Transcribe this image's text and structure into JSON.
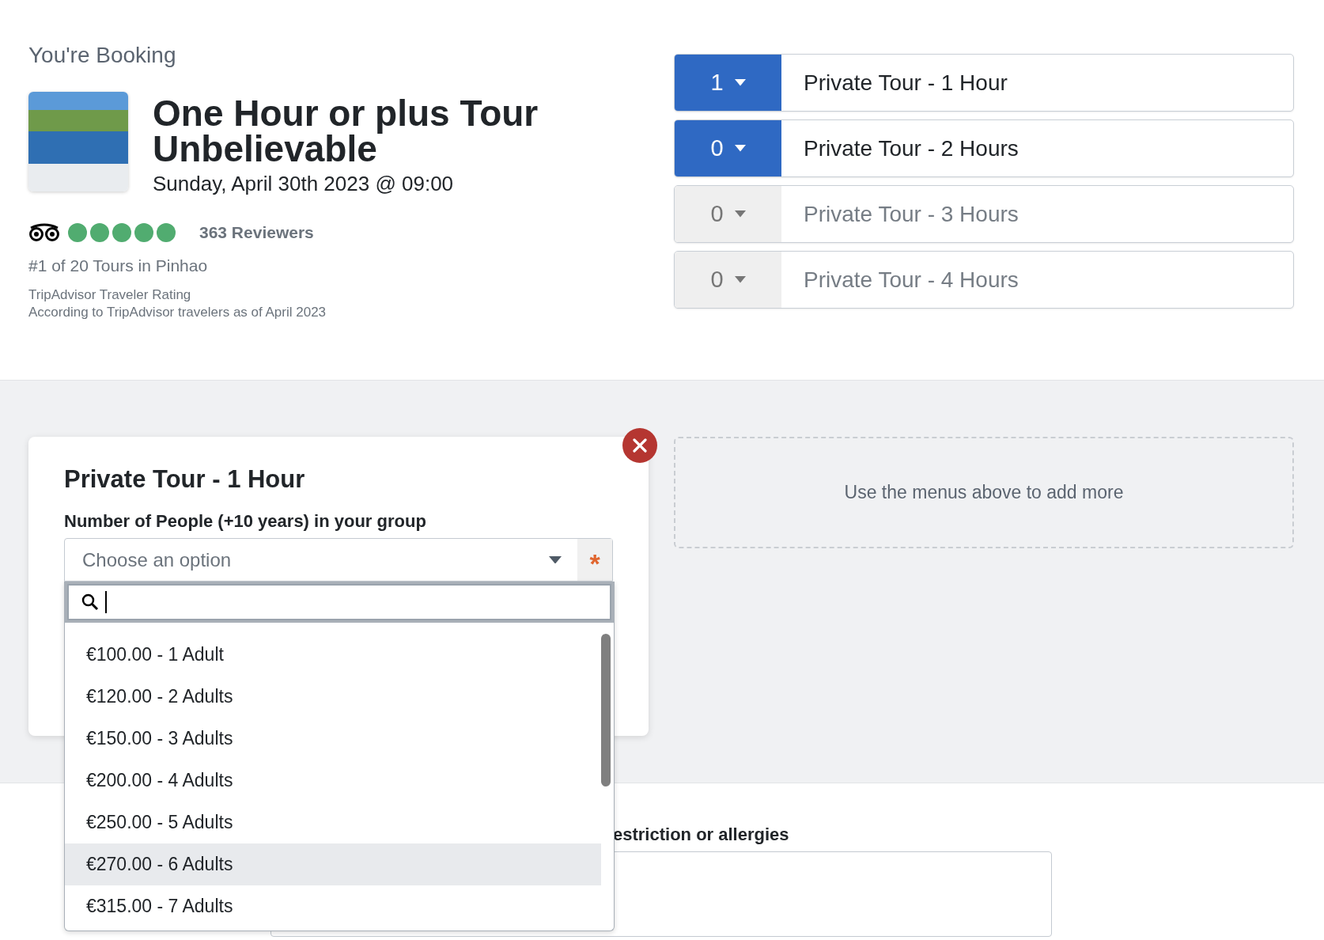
{
  "booking": {
    "heading": "You're Booking",
    "tour_title": "One Hour or plus Tour Unbelievable",
    "date": "Sunday, April 30th 2023 @ 09:00",
    "rating": {
      "stars": 5,
      "reviewers": "363 Reviewers"
    },
    "rank": "#1 of 20 Tours in Pinhao",
    "rating_source": "TripAdvisor Traveler Rating",
    "rating_note": "According to TripAdvisor travelers as of April 2023"
  },
  "tour_options": [
    {
      "count": "1",
      "label": "Private Tour - 1 Hour",
      "disabled": false
    },
    {
      "count": "0",
      "label": "Private Tour - 2 Hours",
      "disabled": false
    },
    {
      "count": "0",
      "label": "Private Tour - 3 Hours",
      "disabled": true
    },
    {
      "count": "0",
      "label": "Private Tour - 4 Hours",
      "disabled": true
    }
  ],
  "selected_tour": {
    "title": "Private Tour - 1 Hour",
    "people_label": "Number of People (+10 years) in your group",
    "select": {
      "placeholder": "Choose an option",
      "required_mark": "*"
    },
    "dropdown": {
      "options": [
        {
          "label": "€100.00 - 1 Adult",
          "highlighted": false
        },
        {
          "label": "€120.00 - 2 Adults",
          "highlighted": false
        },
        {
          "label": "€150.00 - 3 Adults",
          "highlighted": false
        },
        {
          "label": "€200.00 - 4 Adults",
          "highlighted": false
        },
        {
          "label": "€250.00 - 5 Adults",
          "highlighted": false
        },
        {
          "label": "€270.00 - 6 Adults",
          "highlighted": true
        },
        {
          "label": "€315.00 - 7 Adults",
          "highlighted": false
        }
      ]
    }
  },
  "add_more_hint": "Use the menus above to add more",
  "dietary": {
    "label": "estriction or allergies"
  }
}
